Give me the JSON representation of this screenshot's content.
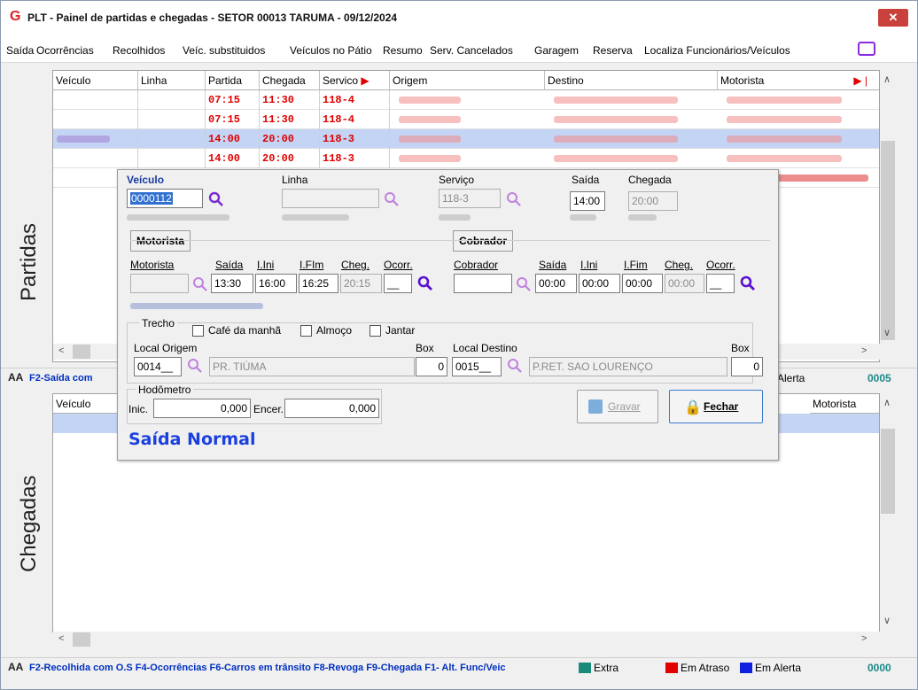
{
  "window": {
    "title": "PLT - Painel de partidas e chegadas  -  SETOR 00013 TARUMA  -  09/12/2024",
    "close": "✕"
  },
  "menu": [
    "Saída",
    "Ocorrências",
    "Recolhidos",
    "Veíc. substituidos",
    "Veículos no Pátio",
    "Resumo",
    "Serv. Cancelados",
    "Garagem",
    "Reserva",
    "Localiza Funcionários/Veículos"
  ],
  "partidas": {
    "label": "Partidas",
    "columns": [
      "Veículo",
      "Linha",
      "Partida",
      "Chegada",
      "Servico",
      "Origem",
      "Destino",
      "Motorista"
    ],
    "rows": [
      {
        "partida": "07:15",
        "chegada": "11:30",
        "servico": "118-4"
      },
      {
        "partida": "07:15",
        "chegada": "11:30",
        "servico": "118-4"
      },
      {
        "partida": "14:00",
        "chegada": "20:00",
        "servico": "118-3"
      },
      {
        "partida": "14:00",
        "chegada": "20:00",
        "servico": "118-3"
      }
    ]
  },
  "status_top": {
    "aa": "AA",
    "keys": "F2-Saída com",
    "alerta": "Alerta",
    "count": "0005"
  },
  "chegadas": {
    "label": "Chegadas",
    "columns": [
      "Veículo",
      "Motorista"
    ]
  },
  "status_bottom": {
    "aa": "AA",
    "keys": "F2-Recolhida com O.S  F4-Ocorrências  F6-Carros em trânsito  F8-Revoga  F9-Chegada  F1- Alt. Func/Veic",
    "extra": "Extra",
    "atraso": "Em Atraso",
    "alerta": "Em Alerta",
    "count": "0000",
    "colors": {
      "extra": "#1a8a7a",
      "atraso": "#e00000",
      "alerta": "#1020e0"
    }
  },
  "dialog": {
    "veiculo_label": "Veículo",
    "veiculo": "0000112",
    "linha_label": "Linha",
    "servico_label": "Serviço",
    "servico": "118-3",
    "saida_label": "Saída",
    "saida": "14:00",
    "chegada_label": "Chegada",
    "chegada": "20:00",
    "motorista_group": "Motorista",
    "cobrador_group": "Cobrador",
    "mot": {
      "motorista": "Motorista",
      "saida": "Saída",
      "iini": "I.Ini",
      "ifim": "I.FIm",
      "cheg": "Cheg.",
      "ocorr": "Ocorr.",
      "v_saida": "13:30",
      "v_iini": "16:00",
      "v_ifim": "16:25",
      "v_cheg": "20:15",
      "v_ocorr": "__"
    },
    "cob": {
      "cobrador": "Cobrador",
      "saida": "Saída",
      "iini": "I.Ini",
      "ifim": "I.Fim",
      "cheg": "Cheg.",
      "ocorr": "Ocorr.",
      "v_saida": "00:00",
      "v_iini": "00:00",
      "v_ifim": "00:00",
      "v_cheg": "00:00",
      "v_ocorr": "__"
    },
    "trecho": "Trecho",
    "cafe": "Café da manhã",
    "almoco": "Almoço",
    "jantar": "Jantar",
    "local_origem": "Local Origem",
    "origem_code": "0014__",
    "origem_name": "PR. TIÚMA",
    "box_label": "Box",
    "box_origem": "0",
    "local_destino": "Local Destino",
    "destino_code": "0015__",
    "destino_name": "P.RET. SAO LOURENÇO",
    "box_destino": "0",
    "hodometro": "Hodômetro",
    "inic_label": "Inic.",
    "inic": "0,000",
    "encer_label": "Encer.",
    "encer": "0,000",
    "gravar": "Gravar",
    "fechar": "Fechar",
    "saida_normal": "Saída Normal"
  }
}
